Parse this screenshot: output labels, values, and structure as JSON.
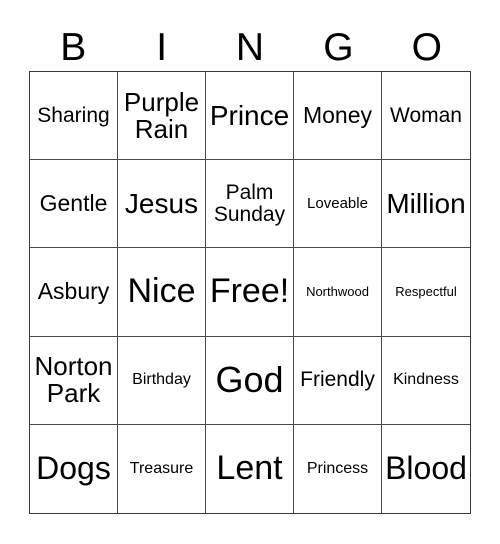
{
  "card": {
    "type": "bingo-card",
    "header_letters": [
      "B",
      "I",
      "N",
      "G",
      "O"
    ],
    "columns": 5,
    "rows": 5,
    "text_color": "#000000",
    "background_color": "#ffffff",
    "border_color": "#4a4a4a",
    "free_space": "Free!",
    "cells": [
      {
        "text": "Sharing",
        "size": "fs-m"
      },
      {
        "text": "Purple\nRain",
        "size": "fs-l"
      },
      {
        "text": "Prince",
        "size": "fs-xl"
      },
      {
        "text": "Money",
        "size": "fs-ml"
      },
      {
        "text": "Woman",
        "size": "fs-m"
      },
      {
        "text": "Gentle",
        "size": "fs-ml"
      },
      {
        "text": "Jesus",
        "size": "fs-xl"
      },
      {
        "text": "Palm\nSunday",
        "size": "fs-m"
      },
      {
        "text": "Loveable",
        "size": "fs-s"
      },
      {
        "text": "Million",
        "size": "fs-xl"
      },
      {
        "text": "Asbury",
        "size": "fs-ml"
      },
      {
        "text": "Nice",
        "size": "fs-xxxl"
      },
      {
        "text": "Free!",
        "size": "fs-xxxl"
      },
      {
        "text": "Northwood",
        "size": "fs-xs"
      },
      {
        "text": "Respectful",
        "size": "fs-xs"
      },
      {
        "text": "Norton\nPark",
        "size": "fs-l"
      },
      {
        "text": "Birthday",
        "size": "fs-sm"
      },
      {
        "text": "God",
        "size": "fs-huge"
      },
      {
        "text": "Friendly",
        "size": "fs-m"
      },
      {
        "text": "Kindness",
        "size": "fs-sm"
      },
      {
        "text": "Dogs",
        "size": "fs-xxl"
      },
      {
        "text": "Treasure",
        "size": "fs-sm"
      },
      {
        "text": "Lent",
        "size": "fs-xxxl"
      },
      {
        "text": "Princess",
        "size": "fs-sm"
      },
      {
        "text": "Blood",
        "size": "fs-xxl"
      }
    ]
  }
}
